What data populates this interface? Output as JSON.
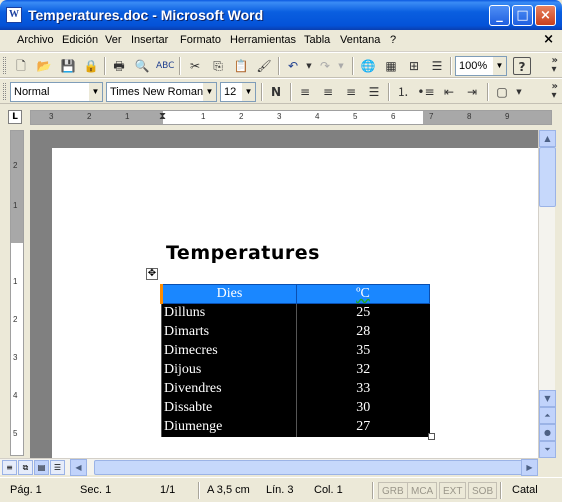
{
  "window": {
    "title": "Temperatures.doc - Microsoft Word",
    "app_icon_letter": "W"
  },
  "menu": [
    "Archivo",
    "Edición",
    "Ver",
    "Insertar",
    "Formato",
    "Herramientas",
    "Tabla",
    "Ventana",
    "?"
  ],
  "standard_toolbar": {
    "zoom": "100%",
    "icons": [
      "new-doc-icon",
      "open-folder-icon",
      "save-icon",
      "permission-icon",
      "print-icon",
      "print-preview-icon",
      "spelling-icon",
      "cut-icon",
      "copy-icon",
      "paste-icon",
      "format-painter-icon",
      "undo-icon",
      "redo-icon",
      "insert-hyperlink-icon",
      "tables-borders-icon",
      "insert-table-icon",
      "columns-icon",
      "help-icon"
    ]
  },
  "formatting_toolbar": {
    "style": "Normal",
    "font": "Times New Roman",
    "size": "12",
    "bold_label": "N"
  },
  "ruler": {
    "horizontal_numbers": [
      "3",
      "2",
      "1",
      "1",
      "2",
      "3",
      "4",
      "5",
      "6",
      "7",
      "8",
      "9"
    ],
    "vertical_numbers": [
      "2",
      "1",
      "1",
      "2",
      "3",
      "4",
      "5"
    ]
  },
  "document": {
    "heading": "Temperatures",
    "table": {
      "headers": [
        "Dies",
        "ºC"
      ],
      "rows": [
        [
          "Dilluns",
          "25"
        ],
        [
          "Dimarts",
          "28"
        ],
        [
          "Dimecres",
          "35"
        ],
        [
          "Dijous",
          "32"
        ],
        [
          "Divendres",
          "33"
        ],
        [
          "Dissabte",
          "30"
        ],
        [
          "Diumenge",
          "27"
        ]
      ]
    }
  },
  "status_bar": {
    "page": "Pág. 1",
    "section": "Sec. 1",
    "pages": "1/1",
    "at": "A 3,5 cm",
    "line": "Lín. 3",
    "column": "Col. 1",
    "modes": [
      "GRB",
      "MCA",
      "EXT",
      "SOB"
    ],
    "language": "Catal"
  },
  "colors": {
    "titlebar": "#0452d8",
    "table_header": "#1a87ff",
    "table_body": "#000000",
    "header_marker": "#ff8c00"
  }
}
